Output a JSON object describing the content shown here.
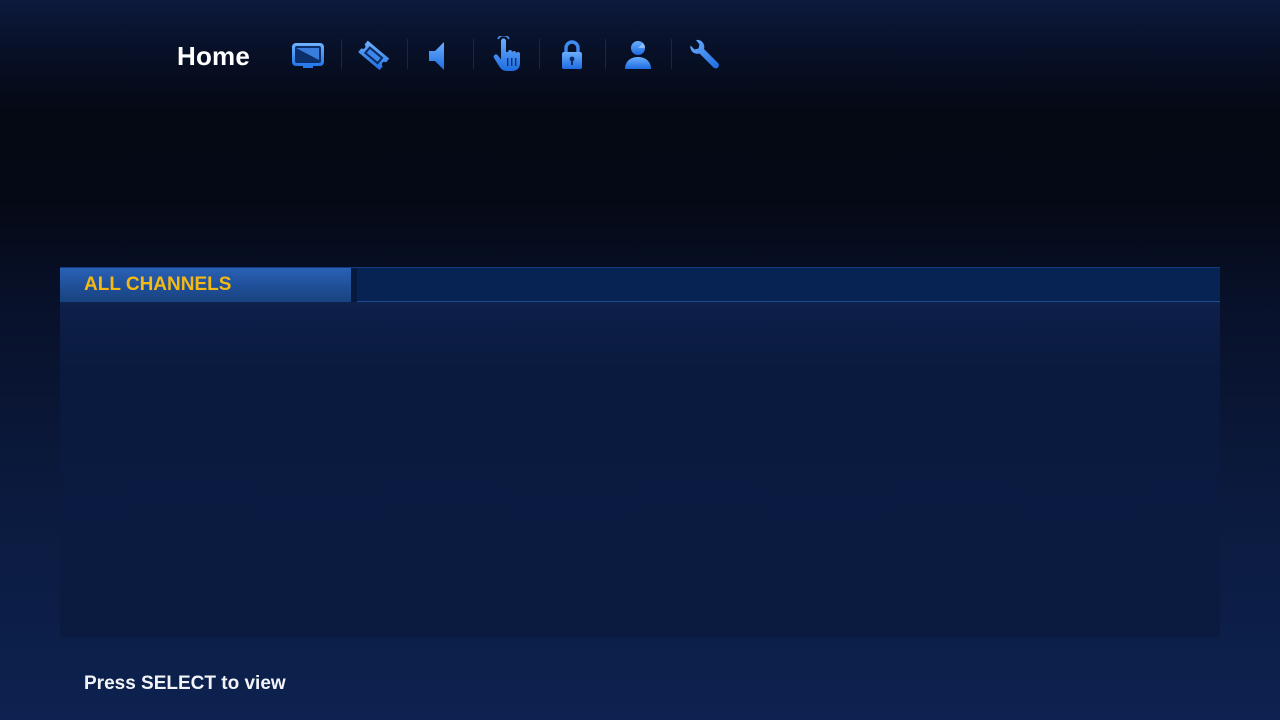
{
  "header": {
    "title": "Home",
    "icons": [
      {
        "name": "tv-icon"
      },
      {
        "name": "ticket-icon"
      },
      {
        "name": "speaker-icon"
      },
      {
        "name": "hand-pointer-icon"
      },
      {
        "name": "lock-icon"
      },
      {
        "name": "user-icon"
      },
      {
        "name": "wrench-icon"
      }
    ]
  },
  "panel": {
    "active_tab": "ALL CHANNELS"
  },
  "footer": {
    "hint": "Press SELECT to view"
  },
  "colors": {
    "accent_tab_text": "#f5b914",
    "icon_blue": "#3a8bf0",
    "tab_blue": "#2a62b5"
  }
}
